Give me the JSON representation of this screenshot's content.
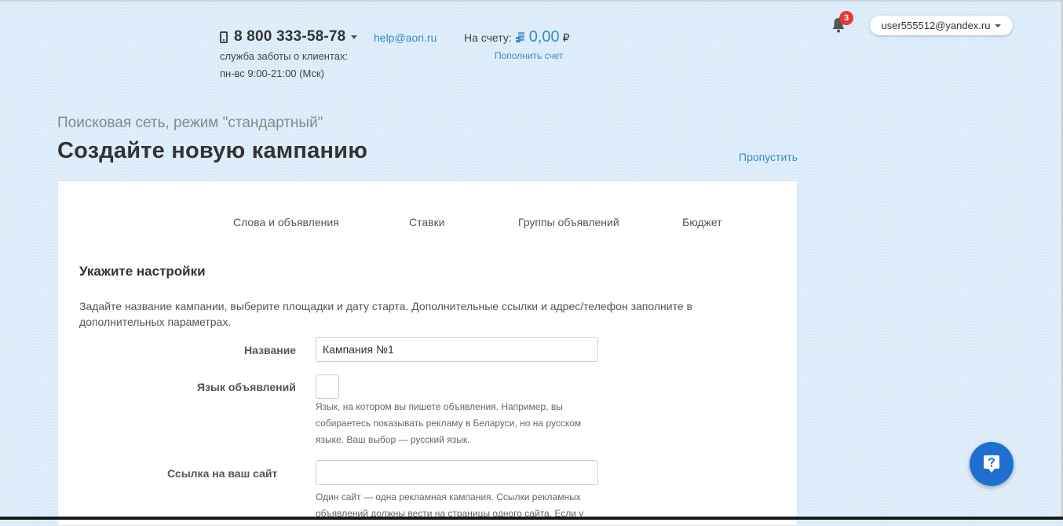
{
  "header": {
    "phone": "8 800 333-58-78",
    "care_line1": "служба заботы о клиентах:",
    "care_line2": "пн-вс 9:00-21:00 (Мск)",
    "email": "help@aori.ru",
    "balance_label": "На счету:",
    "balance_amount": "0,00",
    "currency": "₽",
    "topup": "Пополнить счет",
    "notifications_count": "3",
    "user_email": "user555512@yandex.ru",
    "icons": [
      "phone-icon",
      "chevron-down-icon",
      "coins-icon",
      "bell-icon",
      "question-icon"
    ]
  },
  "page": {
    "subtitle": "Поисковая сеть, режим \"стандартный\"",
    "title": "Создайте новую кампанию",
    "skip": "Пропустить"
  },
  "steps": [
    "Слова и объявления",
    "Ставки",
    "Группы объявлений",
    "Бюджет"
  ],
  "form": {
    "section_title": "Укажите настройки",
    "section_desc": "Задайте название кампании, выберите площадки и дату старта. Дополнительные ссылки и адрес/телефон заполните в дополнительных параметрах.",
    "name_label": "Название",
    "name_value": "Кампания №1",
    "lang_label": "Язык объявлений",
    "lang_hint": "Язык, на котором вы пишете объявления. Например, вы собираетесь показывать рекламу в Беларуси, но на русском языке. Ваш выбор — русский язык.",
    "site_label": "Ссылка на ваш сайт",
    "site_value": "",
    "site_hint": "Один сайт — одна рекламная кампания. Ссылки рекламных объявлений должны вести на страницы одного сайта. Если у"
  },
  "colors": {
    "accent": "#3b8bc7",
    "badge": "#e53935",
    "fab": "#1f6fd1",
    "background": "#dfeefa"
  }
}
